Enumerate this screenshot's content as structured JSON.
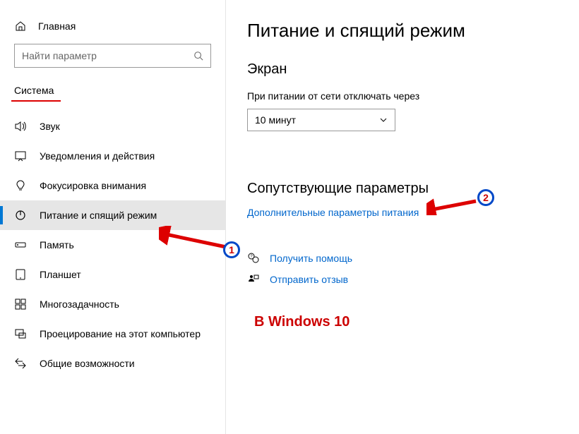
{
  "home_label": "Главная",
  "search": {
    "placeholder": "Найти параметр"
  },
  "section_label": "Система",
  "nav": [
    {
      "label": "Звук"
    },
    {
      "label": "Уведомления и действия"
    },
    {
      "label": "Фокусировка внимания"
    },
    {
      "label": "Питание и спящий режим"
    },
    {
      "label": "Память"
    },
    {
      "label": "Планшет"
    },
    {
      "label": "Многозадачность"
    },
    {
      "label": "Проецирование на этот компьютер"
    },
    {
      "label": "Общие возможности"
    }
  ],
  "page_title": "Питание и спящий режим",
  "screen": {
    "title": "Экран",
    "label": "При питании от сети отключать через",
    "value": "10 минут"
  },
  "related": {
    "title": "Сопутствующие параметры",
    "link": "Дополнительные параметры питания"
  },
  "help": {
    "get_help": "Получить помощь",
    "feedback": "Отправить отзыв"
  },
  "annotations": {
    "num1": "1",
    "num2": "2",
    "caption": "В Windows 10"
  }
}
